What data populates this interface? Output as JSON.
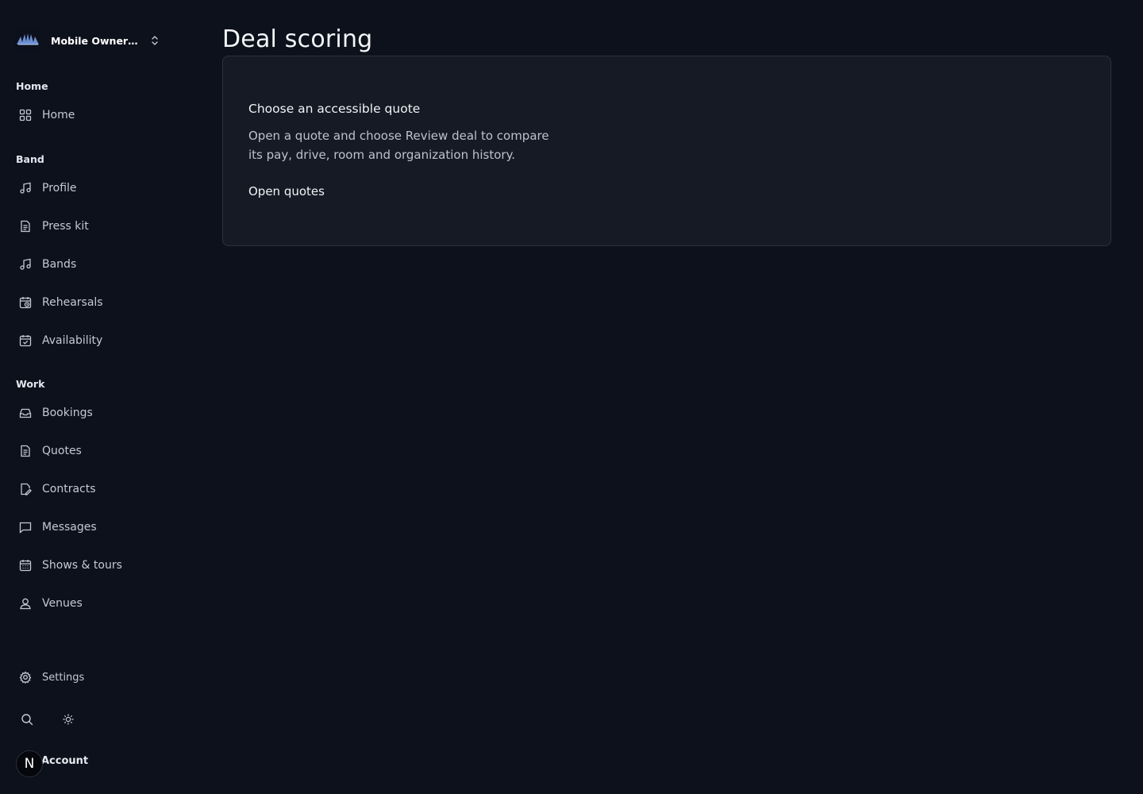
{
  "org": {
    "name": "Mobile Owner Records"
  },
  "sidebar": {
    "sections": [
      {
        "label": "Home",
        "items": [
          {
            "label": "Home",
            "icon": "grid-icon"
          }
        ]
      },
      {
        "label": "Band",
        "items": [
          {
            "label": "Profile",
            "icon": "music-note-icon"
          },
          {
            "label": "Press kit",
            "icon": "document-icon"
          },
          {
            "label": "Bands",
            "icon": "music-note-icon"
          },
          {
            "label": "Rehearsals",
            "icon": "calendar-clock-icon"
          },
          {
            "label": "Availability",
            "icon": "calendar-check-icon"
          }
        ]
      },
      {
        "label": "Work",
        "items": [
          {
            "label": "Bookings",
            "icon": "inbox-icon"
          },
          {
            "label": "Quotes",
            "icon": "document-icon"
          },
          {
            "label": "Contracts",
            "icon": "document-edit-icon"
          },
          {
            "label": "Messages",
            "icon": "message-icon"
          },
          {
            "label": "Shows & tours",
            "icon": "calendar-grid-icon"
          },
          {
            "label": "Venues",
            "icon": "user-pin-icon"
          }
        ]
      }
    ],
    "settings": {
      "label": "Settings",
      "icon": "gear-icon"
    },
    "tools": [
      {
        "icon": "search-icon"
      },
      {
        "icon": "sun-icon"
      }
    ],
    "account": {
      "label": "Account",
      "avatar_letter": "N"
    }
  },
  "main": {
    "title": "Deal scoring",
    "card": {
      "title": "Choose an accessible quote",
      "description": "Open a quote and choose Review deal to compare its pay, drive, room and organization history.",
      "link": "Open quotes"
    }
  },
  "colors": {
    "background": "#0d111b",
    "card": "#161a24",
    "border": "#2c313c",
    "text": "#f1f3f7",
    "muted": "#bcc2cd"
  }
}
